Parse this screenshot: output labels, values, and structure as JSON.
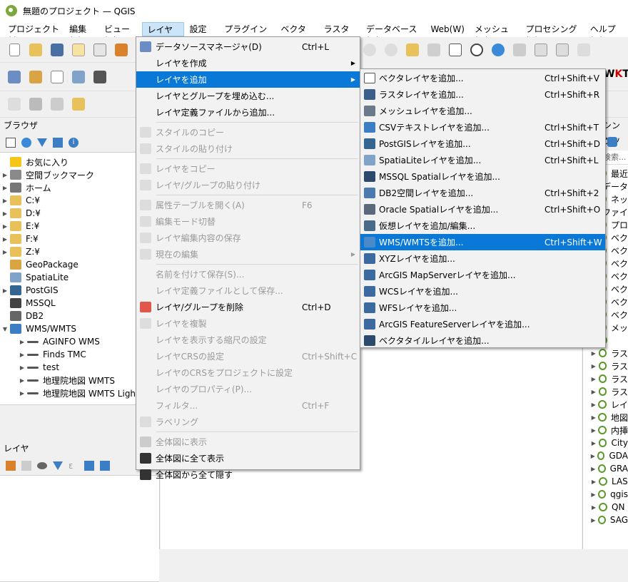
{
  "window": {
    "title": "無題のプロジェクト — QGIS"
  },
  "menubar": [
    "プロジェクト(J)",
    "編集(E)",
    "ビュー(V)",
    "レイヤ(L)",
    "設定(S)",
    "プラグイン(P)",
    "ベクタ(O)",
    "ラスタ(R)",
    "データベース(D)",
    "Web(W)",
    "メッシュ(M)",
    "プロセシング(C)",
    "ヘルプ(H)"
  ],
  "browser": {
    "title": "ブラウザ",
    "items": [
      {
        "label": "お気に入り",
        "arrow": "",
        "icon": "star-icon"
      },
      {
        "label": "空間ブックマーク",
        "arrow": "▶",
        "icon": "bookmark-icon"
      },
      {
        "label": "ホーム",
        "arrow": "▶",
        "icon": "home-folder-icon"
      },
      {
        "label": "C:¥",
        "arrow": "▶",
        "icon": "folder-icon"
      },
      {
        "label": "D:¥",
        "arrow": "▶",
        "icon": "folder-icon"
      },
      {
        "label": "E:¥",
        "arrow": "▶",
        "icon": "folder-icon"
      },
      {
        "label": "F:¥",
        "arrow": "▶",
        "icon": "folder-icon"
      },
      {
        "label": "Z:¥",
        "arrow": "▶",
        "icon": "folder-icon"
      },
      {
        "label": "GeoPackage",
        "arrow": "",
        "icon": "geopackage-icon"
      },
      {
        "label": "SpatiaLite",
        "arrow": "",
        "icon": "spatialite-icon"
      },
      {
        "label": "PostGIS",
        "arrow": "▶",
        "icon": "postgis-icon"
      },
      {
        "label": "MSSQL",
        "arrow": "",
        "icon": "mssql-icon"
      },
      {
        "label": "DB2",
        "arrow": "",
        "icon": "db2-icon"
      },
      {
        "label": "WMS/WMTS",
        "arrow": "▼",
        "icon": "wms-icon"
      },
      {
        "label": "AGINFO WMS",
        "arrow": "▶",
        "icon": "wms-connection-icon",
        "indent": true
      },
      {
        "label": "Finds TMC",
        "arrow": "▶",
        "icon": "wms-connection-icon",
        "indent": true
      },
      {
        "label": "test",
        "arrow": "▶",
        "icon": "wms-connection-icon",
        "indent": true
      },
      {
        "label": "地理院地図 WMTS",
        "arrow": "▶",
        "icon": "wms-connection-icon",
        "indent": true
      },
      {
        "label": "地理院地図 WMTS Ligh",
        "arrow": "▶",
        "icon": "wms-connection-icon",
        "indent": true
      }
    ]
  },
  "layers": {
    "title": "レイヤ"
  },
  "processing": {
    "title": "シングツ",
    "search_placeholder": "検索...",
    "items": [
      {
        "label": "最近"
      },
      {
        "label": "データ"
      },
      {
        "label": "ネッ"
      },
      {
        "label": "ファイ"
      },
      {
        "label": "プロ"
      },
      {
        "label": "ベク"
      },
      {
        "label": "ベク"
      },
      {
        "label": "ベク"
      },
      {
        "label": "ベク"
      },
      {
        "label": "ベク"
      },
      {
        "label": "ベク"
      },
      {
        "label": "ベク"
      },
      {
        "label": "メッ"
      },
      {
        "label": ""
      },
      {
        "label": "ラス"
      },
      {
        "label": "ラス"
      },
      {
        "label": "ラス"
      },
      {
        "label": "ラス"
      },
      {
        "label": "レイ"
      },
      {
        "label": "地図"
      },
      {
        "label": "内挿"
      },
      {
        "label": "City"
      },
      {
        "label": "GDA"
      },
      {
        "label": "GRA"
      },
      {
        "label": "LAS"
      },
      {
        "label": "qgis"
      },
      {
        "label": "QN"
      },
      {
        "label": "SAG"
      }
    ]
  },
  "layer_menu": {
    "items": [
      {
        "label": "データソースマネージャ(D)",
        "shortcut": "Ctrl+L",
        "icon": "data-source-manager-icon",
        "state": "normal"
      },
      {
        "label": "レイヤを作成",
        "shortcut": "",
        "arrow": "▶",
        "state": "normal"
      },
      {
        "label": "レイヤを追加",
        "shortcut": "",
        "arrow": "▶",
        "state": "highlight"
      },
      {
        "label": "レイヤとグループを埋め込む...",
        "shortcut": "",
        "state": "normal"
      },
      {
        "label": "レイヤ定義ファイルから追加...",
        "shortcut": "",
        "state": "normal"
      },
      {
        "sep": true
      },
      {
        "label": "スタイルのコピー",
        "shortcut": "",
        "icon": "copy-style-icon",
        "state": "disabled"
      },
      {
        "label": "スタイルの貼り付け",
        "shortcut": "",
        "icon": "paste-style-icon",
        "state": "disabled"
      },
      {
        "sep": true
      },
      {
        "label": "レイヤをコピー",
        "shortcut": "",
        "icon": "copy-layer-icon",
        "state": "disabled"
      },
      {
        "label": "レイヤ/グループの貼り付け",
        "shortcut": "",
        "icon": "paste-layer-icon",
        "state": "disabled"
      },
      {
        "sep": true
      },
      {
        "label": "属性テーブルを開く(A)",
        "shortcut": "F6",
        "icon": "attribute-table-icon",
        "state": "disabled"
      },
      {
        "label": "編集モード切替",
        "shortcut": "",
        "icon": "pencil-icon",
        "state": "disabled"
      },
      {
        "label": "レイヤ編集内容の保存",
        "shortcut": "",
        "icon": "save-edits-icon",
        "state": "disabled"
      },
      {
        "label": "現在の編集",
        "shortcut": "",
        "arrow": "▶",
        "icon": "current-edits-icon",
        "state": "disabled"
      },
      {
        "sep": true
      },
      {
        "label": "名前を付けて保存(S)...",
        "shortcut": "",
        "state": "disabled"
      },
      {
        "label": "レイヤ定義ファイルとして保存...",
        "shortcut": "",
        "state": "disabled"
      },
      {
        "label": "レイヤ/グループを削除",
        "shortcut": "Ctrl+D",
        "icon": "remove-layer-icon",
        "state": "normal"
      },
      {
        "label": "レイヤを複製",
        "shortcut": "",
        "icon": "duplicate-layer-icon",
        "state": "disabled"
      },
      {
        "label": "レイヤを表示する縮尺の設定",
        "shortcut": "",
        "state": "disabled"
      },
      {
        "label": "レイヤCRSの設定",
        "shortcut": "Ctrl+Shift+C",
        "state": "disabled"
      },
      {
        "label": "レイヤのCRSをプロジェクトに設定",
        "shortcut": "",
        "state": "disabled"
      },
      {
        "label": "レイヤのプロパティ(P)...",
        "shortcut": "",
        "state": "disabled"
      },
      {
        "label": "フィルタ...",
        "shortcut": "Ctrl+F",
        "state": "disabled"
      },
      {
        "label": "ラベリング",
        "shortcut": "",
        "icon": "labeling-icon",
        "state": "disabled"
      },
      {
        "sep": true
      },
      {
        "label": "全体図に表示",
        "shortcut": "",
        "icon": "overview-show-icon",
        "state": "disabled"
      },
      {
        "label": "全体図に全て表示",
        "shortcut": "",
        "icon": "overview-show-all-icon",
        "state": "normal"
      },
      {
        "label": "全体図から全て隠す",
        "shortcut": "",
        "icon": "overview-hide-all-icon",
        "state": "normal"
      }
    ]
  },
  "add_layer_submenu": {
    "items": [
      {
        "label": "ベクタレイヤを追加...",
        "shortcut": "Ctrl+Shift+V",
        "icon": "vector-layer-icon",
        "state": "normal"
      },
      {
        "label": "ラスタレイヤを追加...",
        "shortcut": "Ctrl+Shift+R",
        "icon": "raster-layer-icon",
        "state": "normal"
      },
      {
        "label": "メッシュレイヤを追加...",
        "shortcut": "",
        "icon": "mesh-layer-icon",
        "state": "normal"
      },
      {
        "label": "CSVテキストレイヤを追加...",
        "shortcut": "Ctrl+Shift+T",
        "icon": "csv-layer-icon",
        "state": "normal"
      },
      {
        "label": "PostGISレイヤを追加...",
        "shortcut": "Ctrl+Shift+D",
        "icon": "postgis-layer-icon",
        "state": "normal"
      },
      {
        "label": "SpatiaLiteレイヤを追加...",
        "shortcut": "Ctrl+Shift+L",
        "icon": "spatialite-layer-icon",
        "state": "normal"
      },
      {
        "label": "MSSQL Spatialレイヤを追加...",
        "shortcut": "",
        "icon": "mssql-layer-icon",
        "state": "normal"
      },
      {
        "label": "DB2空間レイヤを追加...",
        "shortcut": "Ctrl+Shift+2",
        "icon": "db2-layer-icon",
        "state": "normal"
      },
      {
        "label": "Oracle Spatialレイヤを追加...",
        "shortcut": "Ctrl+Shift+O",
        "icon": "oracle-layer-icon",
        "state": "normal"
      },
      {
        "label": "仮想レイヤを追加/編集...",
        "shortcut": "",
        "icon": "virtual-layer-icon",
        "state": "normal"
      },
      {
        "label": "WMS/WMTSを追加...",
        "shortcut": "Ctrl+Shift+W",
        "icon": "wms-layer-icon",
        "state": "highlight"
      },
      {
        "label": "XYZレイヤを追加...",
        "shortcut": "",
        "icon": "xyz-layer-icon",
        "state": "normal"
      },
      {
        "label": "ArcGIS MapServerレイヤを追加...",
        "shortcut": "",
        "icon": "arcgis-mapserver-icon",
        "state": "normal"
      },
      {
        "label": "WCSレイヤを追加...",
        "shortcut": "",
        "icon": "wcs-layer-icon",
        "state": "normal"
      },
      {
        "label": "WFSレイヤを追加...",
        "shortcut": "",
        "icon": "wfs-layer-icon",
        "state": "normal"
      },
      {
        "label": "ArcGIS FeatureServerレイヤを追加...",
        "shortcut": "",
        "icon": "arcgis-featureserver-icon",
        "state": "normal"
      },
      {
        "label": "ベクタタイルレイヤを追加...",
        "shortcut": "",
        "icon": "vector-tile-layer-icon",
        "state": "normal"
      }
    ]
  },
  "colors": {
    "highlight": "#0a78d7",
    "accent_green": "#7aa83a",
    "folder": "#e8c15a"
  }
}
